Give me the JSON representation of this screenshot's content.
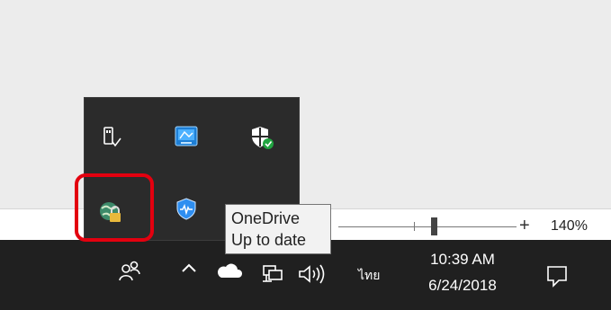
{
  "zoom": {
    "percent_label": "140%",
    "plus_label": "+"
  },
  "tray_flyout": {
    "icons": [
      "usb-eject-icon",
      "monitor-settings-icon",
      "windows-security-icon",
      "vpn-globe-lock-icon",
      "shield-heartbeat-icon"
    ]
  },
  "tooltip": {
    "line1": "OneDrive",
    "line2": "Up to date"
  },
  "taskbar": {
    "input_language": "ไทย",
    "clock_time": "10:39 AM",
    "clock_date": "6/24/2018"
  },
  "colors": {
    "taskbar_bg": "#202020",
    "flyout_bg": "#2b2b2b",
    "highlight": "#e3000f",
    "security_green": "#21a541"
  }
}
